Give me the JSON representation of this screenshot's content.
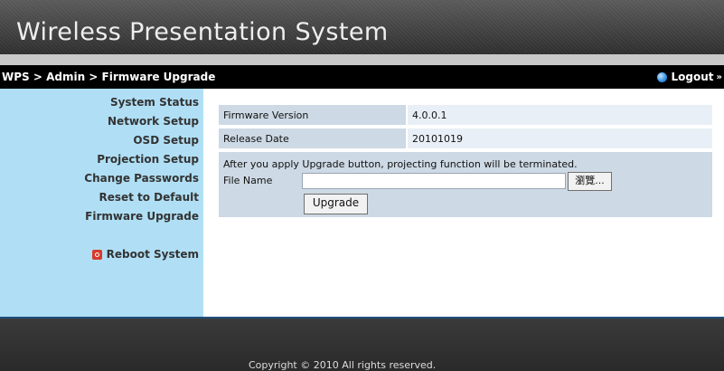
{
  "header": {
    "title": "Wireless Presentation System"
  },
  "navbar": {
    "breadcrumb": "WPS > Admin > Firmware Upgrade",
    "logout_label": "Logout",
    "logout_arrows": "»"
  },
  "sidebar": {
    "items": [
      {
        "label": "System Status"
      },
      {
        "label": "Network Setup"
      },
      {
        "label": "OSD Setup"
      },
      {
        "label": "Projection Setup"
      },
      {
        "label": "Change Passwords"
      },
      {
        "label": "Reset to Default"
      },
      {
        "label": "Firmware Upgrade"
      }
    ],
    "reboot_label": "Reboot System"
  },
  "firmware": {
    "version_label": "Firmware Version",
    "version_value": "4.0.0.1",
    "release_label": "Release Date",
    "release_value": "20101019"
  },
  "upgrade": {
    "notice": "After you apply Upgrade button, projecting function will be terminated.",
    "file_label": "File Name",
    "file_value": "",
    "browse_label": "瀏覽...",
    "upgrade_label": "Upgrade"
  },
  "footer": {
    "copyright": "Copyright © 2010 All rights reserved."
  }
}
